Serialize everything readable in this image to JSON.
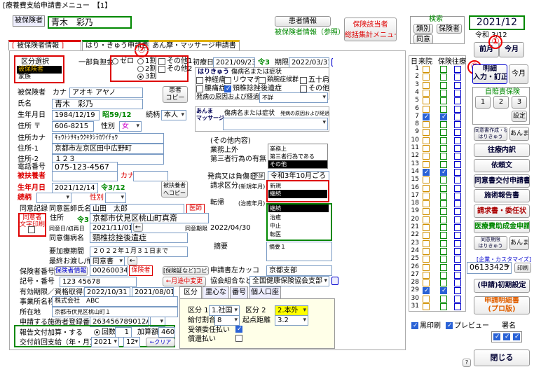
{
  "window": {
    "title": "[療養費支給申請書メニュー　【1】"
  },
  "header": {
    "patient_label": "被保険者",
    "patient_name": "青木　彩乃",
    "insurer_info_btn": "患者情報",
    "insured_info_link": "被保険者情報（参照）",
    "insurer_summary_btn": "保険該当者\n総括集計メニュー",
    "search_label": "検索",
    "search_btns": [
      "類別",
      "保険者",
      "同意"
    ],
    "date": "2021/12",
    "reiwa": "令和 3/12",
    "prev_month": "前月",
    "next_month": "今月"
  },
  "tabs": [
    "被保険者情報",
    "はり・きゅう申請書",
    "あん摩・マッサージ申請書"
  ],
  "region": {
    "title": "区分選択",
    "items": [
      "被保険者",
      "家族"
    ]
  },
  "burden": {
    "label": "一部負担金",
    "opts": [
      "ゼロ",
      "1割",
      "2割",
      "3割"
    ],
    "opts2": [
      "その他1",
      "その他2"
    ]
  },
  "insured": {
    "label": "被保険者",
    "kana_label": "カナ",
    "kana": "アオキ アヤノ",
    "copy_btn": "患者\nコピー",
    "name_label": "氏名",
    "name": "青木　彩乃",
    "dob_label": "生年月日",
    "dob": "1984/12/19",
    "dob_era": "昭59/12",
    "relation_label": "続柄",
    "relation": "本人",
    "addr_label": "住所 〒",
    "zip": "606-8215",
    "sex_label": "性別",
    "sex": "女",
    "kana_addr_label": "住所カナ",
    "kana_addr": "ｷｮｳﾄｼｻｷｮｳｸｷﾀｼﾗｶﾜｲﾁｮｳ",
    "addr1_label": "住所-1",
    "addr1": "京都市左京区田中広野町",
    "addr2_label": "住所-2",
    "addr2": "１２３",
    "tel_label": "電話番号",
    "tel": "075-123-4567",
    "dep_label": "被扶養者",
    "dep_kana": "カナ",
    "dep_dob_label": "生年月日",
    "dep_dob": "2021/12/14",
    "dep_era": "令3/12",
    "dep_copy": "被扶養者\nへコピー",
    "dep_rel_label": "続柄",
    "dep_sex_label": "性別"
  },
  "consent": {
    "record_label": "同意記録",
    "doctor_label": "同意医師氏名",
    "doctor": "山田　太郎",
    "doctor_tag": "医師",
    "print_label": "同意者\n文字印刷",
    "addr_label": "住所",
    "addr_era": "令3",
    "addr": "京都市伏見区桃山町真斎",
    "date_label": "同意日/初再日",
    "date": "2021/11/01",
    "period_label": "同意期限",
    "period": "2022/04/30",
    "disease_label": "同意傷病名",
    "disease": "頸椎捻挫後遺症",
    "req_label": "要加療期間",
    "req": "２０２２年１月３１日まで",
    "last_label": "最終お渡し/備考",
    "last": "同意書"
  },
  "insurer": {
    "no_label": "保険者番号",
    "info_btn": "保険者情報",
    "no": "00260034",
    "tag": "保険者",
    "copy_btn": "[保険証など]コピー",
    "sign_label": "記号・番号",
    "sign": "123 45678",
    "move_btn": "←月途中変更",
    "valid_label": "有効期限／資格取得日",
    "valid": "2022/10/31",
    "acquired": "2021/08/01",
    "office_label": "事業所名称",
    "office": "株式会社　ABC",
    "loc_label": "所在地",
    "loc": "京都市伏見区桃山町１",
    "prac_label": "申請する施術者登録番号",
    "prac": "263456789012AW"
  },
  "visits": {
    "label": "報告文付加算・する",
    "times_label": "回数",
    "times": "1",
    "add_label": "加算額",
    "add": "460",
    "paid_label": "交付前回支給（年・月）",
    "year": "2021",
    "month": "12",
    "clear_btn": "←クリア"
  },
  "bottom_tabs": [
    "区分",
    "里心など",
    "番号",
    "個人口座"
  ],
  "class_panel": {
    "k1_label": "区分 1",
    "k1": "1.社国",
    "k2_label": "区分 2",
    "k2": "2.本外",
    "rate_label": "給付割合",
    "rate": "8",
    "start_label": "起点距離",
    "start": "3.2",
    "recv_label": "受領委任払い",
    "recp_label": "償還払い"
  },
  "treatment": {
    "first_label": "初療日",
    "first": "2021/09/23",
    "first_era": "令3",
    "period_label": "期限",
    "period": "2022/03/31",
    "hari_title": "はりきゅう",
    "hari_sub": "傷病名または症状",
    "diseases": [
      "神経痛",
      "リウマチ",
      "頚腕症候群",
      "五十肩",
      "腰痛症",
      "頸椎捻挫後遺症",
      "その他"
    ],
    "cause_label": "発病の原因および経過",
    "cause": "不詳",
    "anma_title": "あんま\nマッサージ",
    "anma_sub": "傷病名または症状",
    "anma_cause": "発病の原因および経過",
    "other_label": "(その他内容)",
    "work_label": "業務上外",
    "third_label": "第三者行為の有無",
    "work_opts": [
      "業務上",
      "第三者行為である",
      "その他"
    ],
    "onset_label": "発病又は負傷日",
    "onset_tag": "不詳",
    "onset": "令和3年10月ごろ",
    "req_label": "請求区分",
    "req_sub": "(新規年月)",
    "req_opts": [
      "新規",
      "継続"
    ],
    "tenki_label": "転帰",
    "tenki_sub": "(治癒年月)",
    "tenki_opts": [
      "継続",
      "治癒",
      "中止",
      "転医"
    ],
    "summary_label": "摘要",
    "summary": "摘要１",
    "submit_label": "申請書左カッコ",
    "submit": "京都支部",
    "assoc_label": "協会組合など",
    "assoc": "全国健康保険協会支部"
  },
  "days": {
    "headers": [
      "日",
      "来院",
      "保険",
      "往療"
    ],
    "rows": [
      1,
      2,
      3,
      4,
      5,
      6,
      7,
      8,
      9,
      10,
      11,
      12,
      13,
      14,
      15,
      16,
      17,
      18,
      19,
      20,
      21,
      22,
      23,
      24,
      25,
      26,
      27,
      28,
      29,
      30,
      31
    ],
    "visit": [
      7,
      14,
      29
    ],
    "ins": [
      7,
      14,
      29
    ],
    "home": []
  },
  "right": {
    "detail_btn": "明細\n入力・訂正",
    "this_month": "今月",
    "self_pay": "自賠責保険",
    "nums": [
      "1",
      "2",
      "3"
    ],
    "setting": "設定",
    "cond": "同意書作成・状態\nはりきゅう",
    "anma": "あんま",
    "btns": [
      "往療内訳",
      "依頼文",
      "同意書交付申請書",
      "施術報告書",
      "請求書・委任状",
      "医療費助成金申請"
    ],
    "cond2": "同意期限\nはりきゅう",
    "anma2": "あんま",
    "corp": "[企業・カスタマイズ]",
    "corp_val": "06133425",
    "print": "印刷",
    "init": "(申請)初期設定",
    "detail2": "申請明細書\n(プロ版)",
    "close": "閉じる",
    "help": "?"
  },
  "bottomopts": {
    "black": "黒印刷",
    "preview": "プレビュー",
    "sign": "署名"
  },
  "markers": [
    "①",
    "②",
    "③"
  ]
}
